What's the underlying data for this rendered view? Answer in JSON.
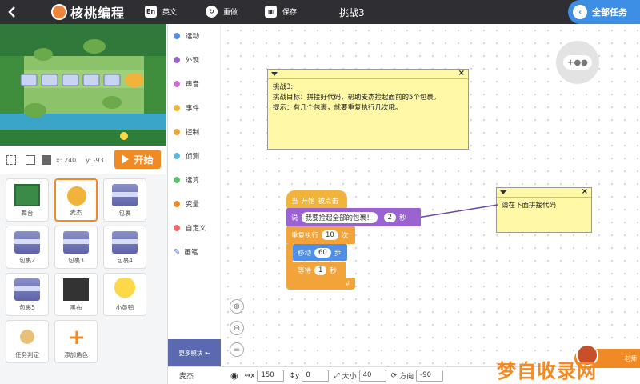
{
  "topbar": {
    "logo_text": "核桃编程",
    "tools": [
      {
        "icon": "En",
        "label": "英文"
      },
      {
        "icon": "↻",
        "label": "重做"
      },
      {
        "icon": "▣",
        "label": "保存"
      }
    ],
    "title": "挑战3",
    "all_tasks": "全部任务",
    "bg_color": "#2e2e33",
    "accent": "#3d8fe6"
  },
  "stage": {
    "x_label": "x: 240",
    "y_label": "y: -93",
    "start_button": "开始"
  },
  "sprites": [
    {
      "label": "舞台",
      "kind": "stage"
    },
    {
      "label": "麦杰",
      "kind": "character",
      "selected": true
    },
    {
      "label": "包裹",
      "kind": "box"
    },
    {
      "label": "包裹2",
      "kind": "box"
    },
    {
      "label": "包裹3",
      "kind": "box"
    },
    {
      "label": "包裹4",
      "kind": "box"
    },
    {
      "label": "包裹5",
      "kind": "box"
    },
    {
      "label": "黑布",
      "kind": "dark"
    },
    {
      "label": "小黄鸭",
      "kind": "duck"
    },
    {
      "label": "任务判定",
      "kind": "flag"
    },
    {
      "label": "添加角色",
      "kind": "add"
    }
  ],
  "categories": [
    {
      "label": "运动",
      "color": "#4f8fe6"
    },
    {
      "label": "外观",
      "color": "#9a63d1"
    },
    {
      "label": "声音",
      "color": "#d06bd6"
    },
    {
      "label": "事件",
      "color": "#f2b33a"
    },
    {
      "label": "控制",
      "color": "#f2a43a"
    },
    {
      "label": "侦测",
      "color": "#5cb8e0"
    },
    {
      "label": "运算",
      "color": "#5ac26a"
    },
    {
      "label": "变量",
      "color": "#f08a24"
    },
    {
      "label": "自定义",
      "color": "#f06a6a"
    },
    {
      "label": "画笔",
      "color": "#3aa0a0"
    }
  ],
  "more_blocks": "更多模块",
  "notes": {
    "challenge": {
      "line1": "挑战3:",
      "line2": "挑战目标：拼接好代码，帮助麦杰捡起面前的5个包裹。",
      "line3": "提示：有几个包裹，就要重复执行几次哦。"
    },
    "hint": "请在下面拼接代码"
  },
  "blocks": {
    "hat": {
      "pre": "当",
      "key": "开始",
      "post": "被点击"
    },
    "say": {
      "label": "说",
      "text": "我要捡起全部的包裹！",
      "secs": "2",
      "unit": "秒"
    },
    "repeat": {
      "label": "重复执行",
      "count": "10",
      "unit": "次"
    },
    "move": {
      "label": "移动",
      "steps": "60",
      "unit": "步"
    },
    "wait": {
      "label": "等待",
      "secs": "1",
      "unit": "秒"
    }
  },
  "bottom_bar": {
    "sprite_name": "麦杰",
    "x_label": "x",
    "x": "150",
    "y_label": "y",
    "y": "0",
    "size_label": "大小",
    "size": "40",
    "dir_label": "方向",
    "dir": "-90"
  },
  "teacher": "老师",
  "watermark": "梦自收录网"
}
